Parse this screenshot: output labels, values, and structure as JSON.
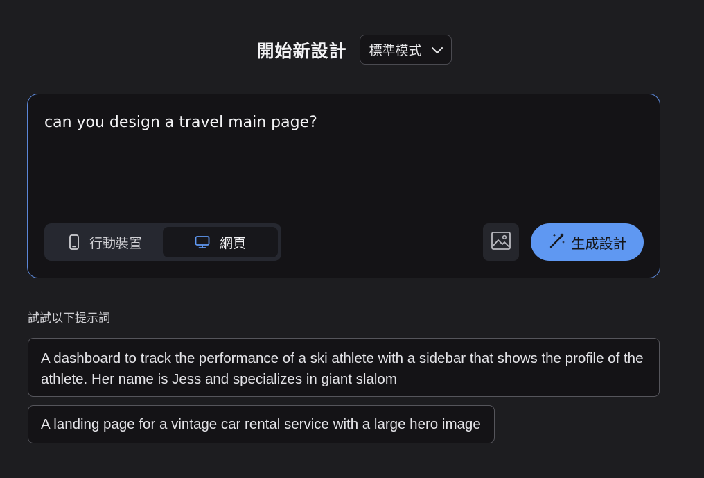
{
  "header": {
    "title": "開始新設計",
    "mode_select": {
      "selected": "標準模式",
      "icon": "chevron-down-icon"
    }
  },
  "prompt": {
    "text": "can you design a travel main page?"
  },
  "device_toggle": {
    "options": [
      {
        "label": "行動裝置",
        "icon": "mobile-icon",
        "active": false
      },
      {
        "label": "網頁",
        "icon": "monitor-icon",
        "active": true
      }
    ]
  },
  "actions": {
    "image_icon": "image-icon",
    "generate_label": "生成設計",
    "generate_icon": "magic-wand-icon"
  },
  "suggestions": {
    "heading": "試試以下提示詞",
    "items": [
      "A dashboard to track the performance of a ski athlete with a sidebar that shows the profile of the athlete. Her name is Jess and specializes in giant slalom",
      "A landing page for a vintage car rental service with a large hero image"
    ]
  },
  "colors": {
    "background": "#1d1d20",
    "accent": "#5f98f2",
    "focus_border": "#5b86d6",
    "monitor_icon": "#5f98f2"
  }
}
